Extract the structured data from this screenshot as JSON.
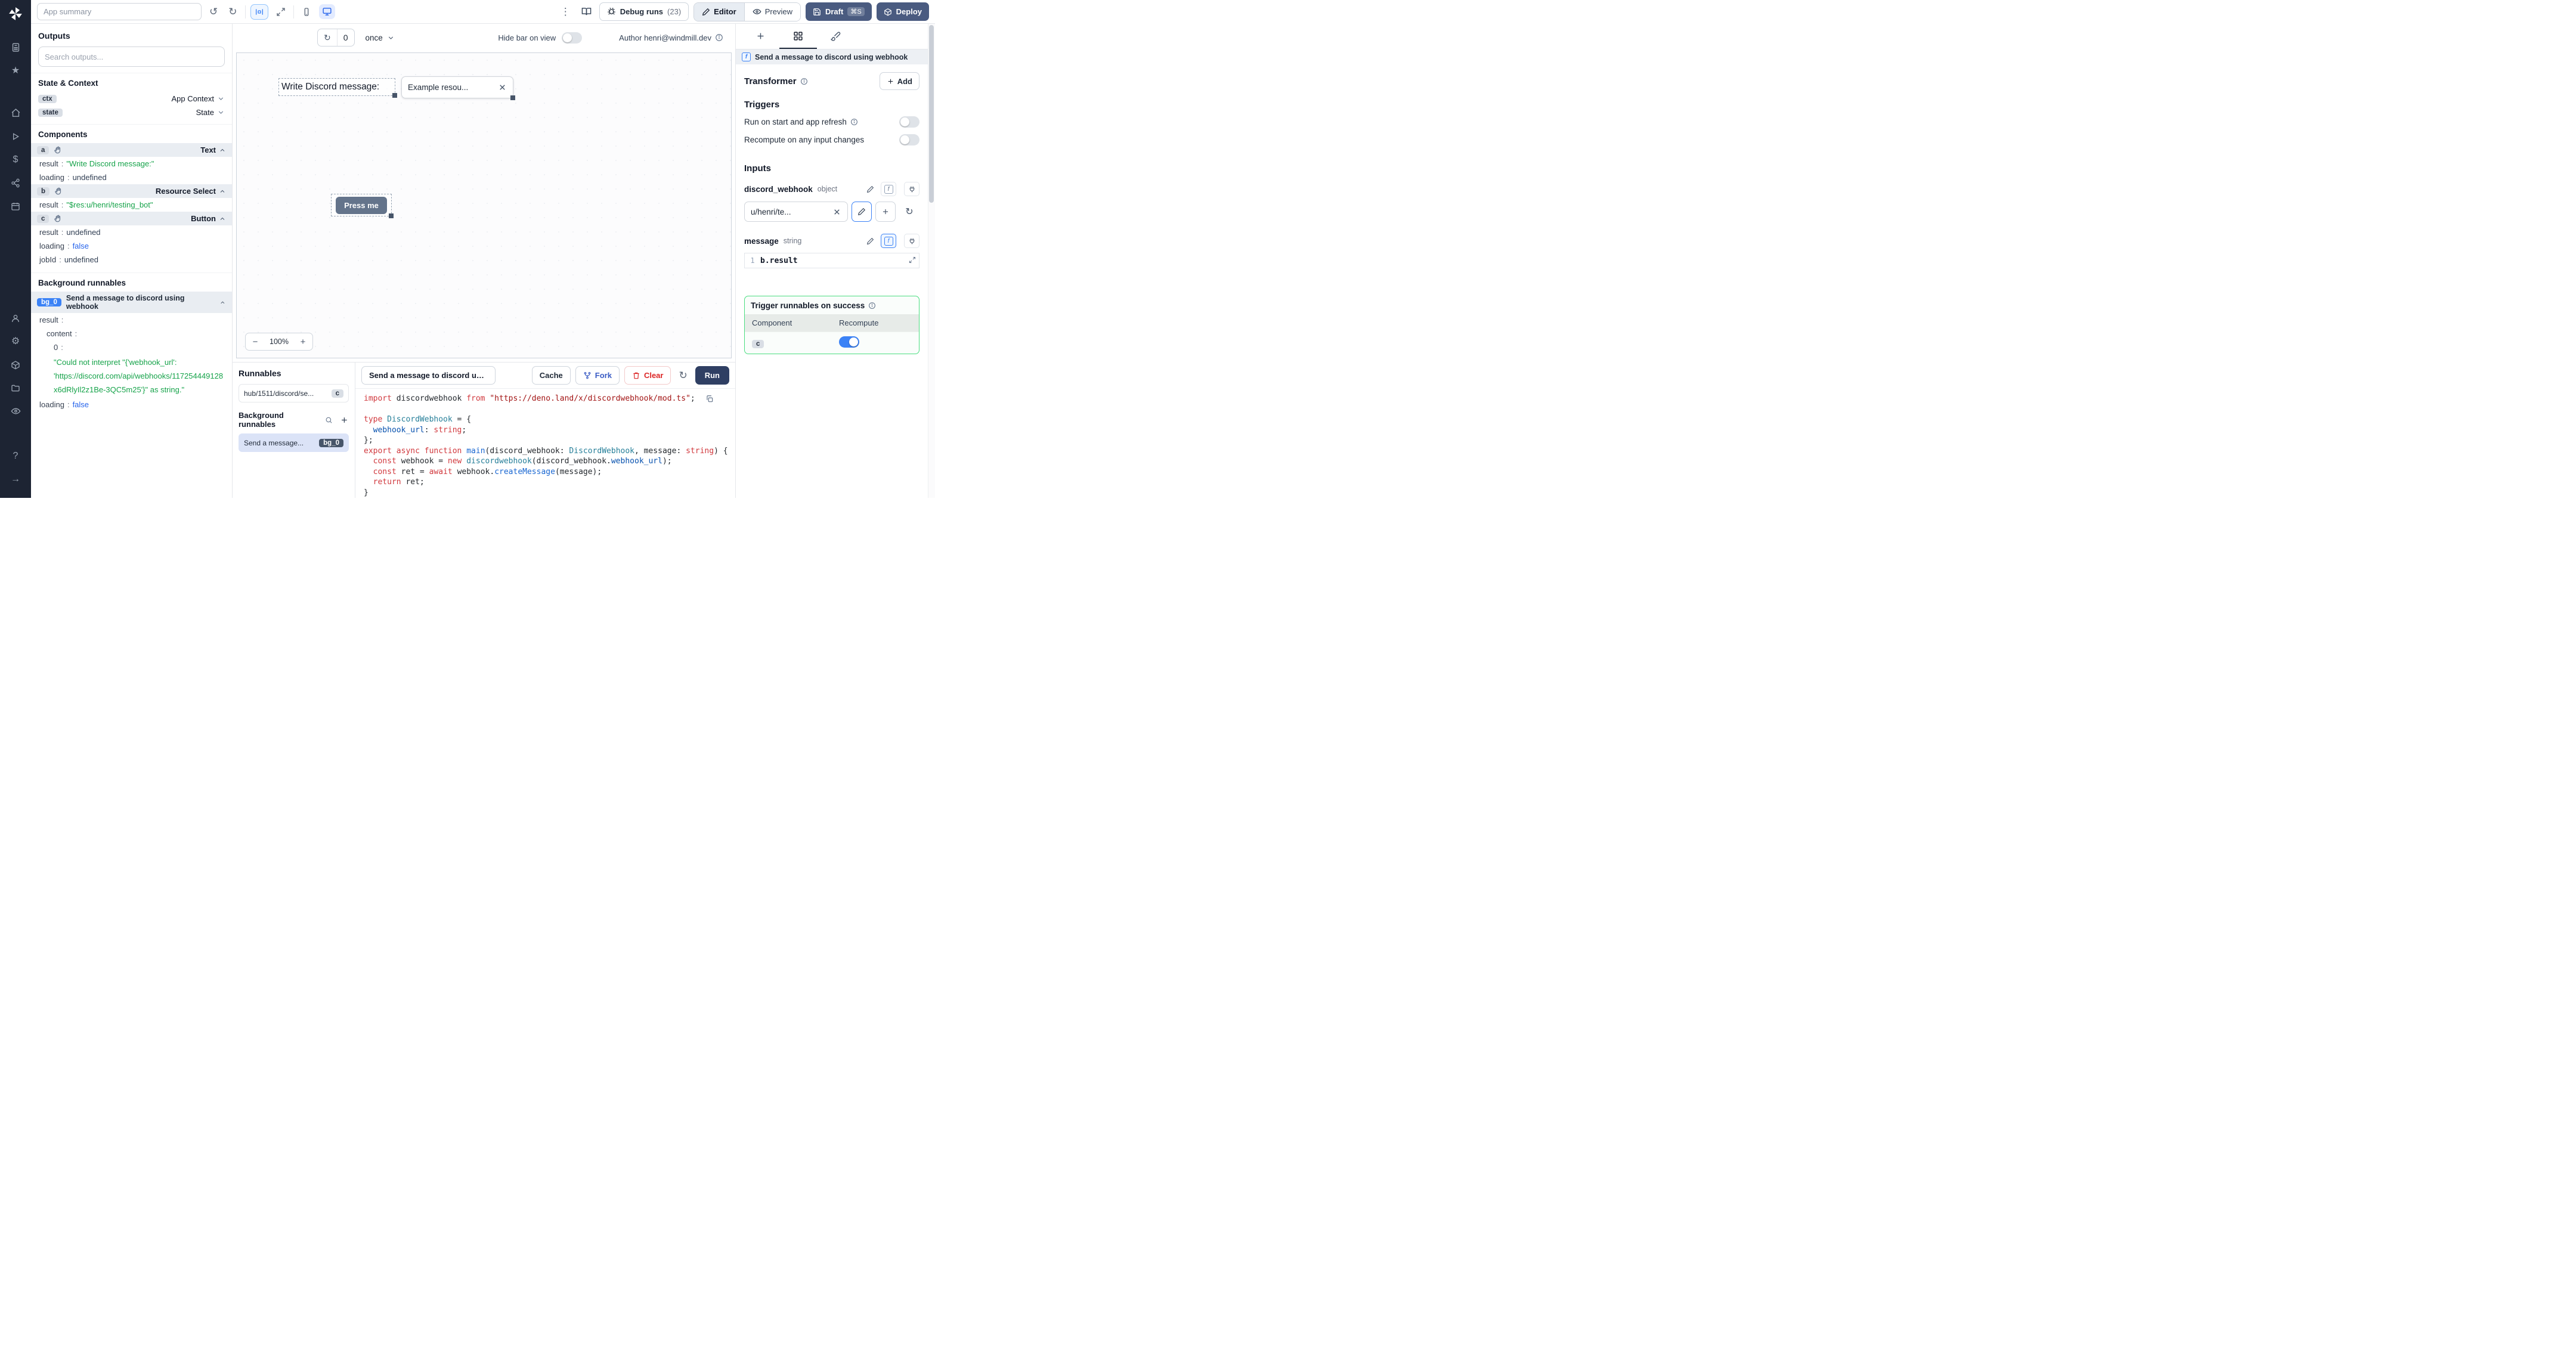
{
  "glyphs": {
    "undo": "↺",
    "redo": "↻",
    "kebab": "⋮",
    "refresh": "↻",
    "star": "★",
    "dollar": "$",
    "gear": "⚙",
    "question": "?",
    "arrow_right": "→",
    "minus": "−",
    "plus": "+",
    "colon": ":",
    "fx": "f"
  },
  "topbar": {
    "app_summary_placeholder": "App summary",
    "debug_runs_label": "Debug runs",
    "debug_runs_count": "(23)",
    "editor_label": "Editor",
    "preview_label": "Preview",
    "draft_label": "Draft",
    "draft_shortcut": "⌘S",
    "deploy_label": "Deploy"
  },
  "outputs": {
    "title": "Outputs",
    "search_placeholder": "Search outputs...",
    "state_context_title": "State & Context",
    "ctx_badge": "ctx",
    "ctx_label": "App Context",
    "state_badge": "state",
    "state_label": "State",
    "components_title": "Components",
    "comp_a": {
      "badge": "a",
      "type": "Text",
      "k1": "result",
      "v1": "\"Write Discord message:\"",
      "k2": "loading",
      "v2": "undefined"
    },
    "comp_b": {
      "badge": "b",
      "type": "Resource Select",
      "k1": "result",
      "v1": "\"$res:u/henri/testing_bot\""
    },
    "comp_c": {
      "badge": "c",
      "type": "Button",
      "k1": "result",
      "v1": "undefined",
      "k2": "loading",
      "v2": "false",
      "k3": "jobId",
      "v3": "undefined"
    },
    "bg_title": "Background runnables",
    "bg0": {
      "badge": "bg_0",
      "label": "Send a message to discord using webhook",
      "k1": "result",
      "k2": "content",
      "k3": "0",
      "str": "\"Could not interpret \"{'webhook_url': 'https://discord.com/api/webhooks/117254449128x6dRlyIl2z1Be-3QC5m25'}\" as string.\"",
      "k4": "loading",
      "v4": "false"
    }
  },
  "canvas_bar": {
    "count": "0",
    "schedule": "once",
    "hide_label": "Hide bar on view",
    "author": "Author henri@windmill.dev"
  },
  "canvas": {
    "text": "Write Discord message:",
    "select_value": "Example resou...",
    "button": "Press me",
    "zoom": "100%"
  },
  "runnables": {
    "title": "Runnables",
    "item_path": "hub/1511/discord/se...",
    "item_badge": "c",
    "bg_title": "Background runnables",
    "bg_label": "Send a message...",
    "bg_badge": "bg_0"
  },
  "editor": {
    "tab": "Send a message to discord using",
    "cache": "Cache",
    "fork": "Fork",
    "clear": "Clear",
    "run": "Run",
    "code": [
      {
        "tokens": [
          {
            "t": "import ",
            "c": "kw"
          },
          {
            "t": "discordwebhook ",
            "c": "pl"
          },
          {
            "t": "from ",
            "c": "kw"
          },
          {
            "t": "\"https://deno.land/x/discordwebhook/mod.ts\"",
            "c": "str"
          },
          {
            "t": ";",
            "c": "pl"
          }
        ]
      },
      {
        "tokens": []
      },
      {
        "tokens": [
          {
            "t": "type ",
            "c": "kw"
          },
          {
            "t": "DiscordWebhook",
            "c": "ty"
          },
          {
            "t": " = {",
            "c": "pl"
          }
        ]
      },
      {
        "tokens": [
          {
            "t": "  ",
            "c": "pl"
          },
          {
            "t": "webhook_url",
            "c": "pr"
          },
          {
            "t": ": ",
            "c": "pl"
          },
          {
            "t": "string",
            "c": "kw"
          },
          {
            "t": ";",
            "c": "pl"
          }
        ]
      },
      {
        "tokens": [
          {
            "t": "};",
            "c": "pl"
          }
        ]
      },
      {
        "tokens": [
          {
            "t": "export ",
            "c": "kw"
          },
          {
            "t": "async ",
            "c": "kw"
          },
          {
            "t": "function ",
            "c": "kw"
          },
          {
            "t": "main",
            "c": "fn"
          },
          {
            "t": "(discord_webhook: ",
            "c": "pl"
          },
          {
            "t": "DiscordWebhook",
            "c": "ty"
          },
          {
            "t": ", message: ",
            "c": "pl"
          },
          {
            "t": "string",
            "c": "kw"
          },
          {
            "t": ") {",
            "c": "pl"
          }
        ]
      },
      {
        "tokens": [
          {
            "t": "  ",
            "c": "pl"
          },
          {
            "t": "const ",
            "c": "kw"
          },
          {
            "t": "webhook",
            "c": "pl"
          },
          {
            "t": " = ",
            "c": "pl"
          },
          {
            "t": "new ",
            "c": "kw"
          },
          {
            "t": "discordwebhook",
            "c": "ty"
          },
          {
            "t": "(discord_webhook.",
            "c": "pl"
          },
          {
            "t": "webhook_url",
            "c": "pr"
          },
          {
            "t": ");",
            "c": "pl"
          }
        ]
      },
      {
        "tokens": [
          {
            "t": "  ",
            "c": "pl"
          },
          {
            "t": "const ",
            "c": "kw"
          },
          {
            "t": "ret",
            "c": "pl"
          },
          {
            "t": " = ",
            "c": "pl"
          },
          {
            "t": "await ",
            "c": "kw"
          },
          {
            "t": "webhook.",
            "c": "pl"
          },
          {
            "t": "createMessage",
            "c": "fn"
          },
          {
            "t": "(message);",
            "c": "pl"
          }
        ]
      },
      {
        "tokens": [
          {
            "t": "  ",
            "c": "pl"
          },
          {
            "t": "return ",
            "c": "kw"
          },
          {
            "t": "ret;",
            "c": "pl"
          }
        ]
      },
      {
        "tokens": [
          {
            "t": "}",
            "c": "pl"
          }
        ]
      }
    ]
  },
  "panel": {
    "header": "Send a message to discord using webhook",
    "transformer": "Transformer",
    "add": "Add",
    "triggers_title": "Triggers",
    "trigger1": "Run on start and app refresh",
    "trigger2": "Recompute on any input changes",
    "inputs_title": "Inputs",
    "input1_name": "discord_webhook",
    "input1_type": "object",
    "input1_value": "u/henri/te...",
    "input2_name": "message",
    "input2_type": "string",
    "code_line_no": "1",
    "code_value": "b.result",
    "success_title": "Trigger runnables on success",
    "col_component": "Component",
    "col_recompute": "Recompute",
    "row_badge": "c"
  }
}
